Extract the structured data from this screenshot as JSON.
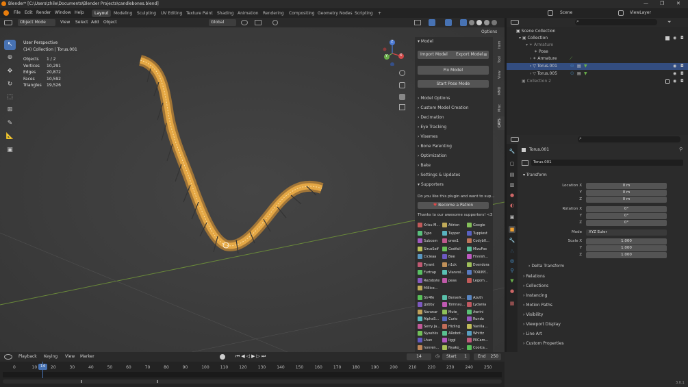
{
  "window": {
    "title": "Blender* [C:\\Users\\zhile\\Documents\\Blender Projects\\candlebones.blend]",
    "min_label": "—",
    "max_label": "❐",
    "close_label": "✕"
  },
  "menu": {
    "items": [
      "File",
      "Edit",
      "Render",
      "Window",
      "Help"
    ]
  },
  "workspaces": [
    "Layout",
    "Modeling",
    "Sculpting",
    "UV Editing",
    "Texture Paint",
    "Shading",
    "Animation",
    "Rendering",
    "Compositing",
    "Geometry Nodes",
    "Scripting"
  ],
  "workspace_add": "+",
  "scene": {
    "scene_label": "Scene",
    "viewlayer_label": "ViewLayer"
  },
  "viewport_header": {
    "mode": "Object Mode",
    "menus": [
      "View",
      "Select",
      "Add",
      "Object"
    ],
    "transform_orientation": "Global",
    "options_label": "Options"
  },
  "viewport_info": {
    "view_name": "User Perspective",
    "collection": "(14) Collection | Torus.001",
    "stats": [
      {
        "label": "Objects",
        "value": "1 / 2"
      },
      {
        "label": "Vertices",
        "value": "10,291"
      },
      {
        "label": "Edges",
        "value": "20,872"
      },
      {
        "label": "Faces",
        "value": "10,592"
      },
      {
        "label": "Triangles",
        "value": "19,526"
      }
    ]
  },
  "gizmo": {
    "x": "X",
    "y": "Y",
    "z": "Z"
  },
  "npanel": {
    "title": "Model",
    "import_label": "Import Model",
    "export_label": "Export Model",
    "fix_label": "Fix Model",
    "pose_label": "Start Pose Mode",
    "sections": [
      "Model Options",
      "Custom Model Creation",
      "Decimation",
      "Eye Tracking",
      "Visemes",
      "Bone Parenting",
      "Optimization",
      "Bake",
      "Settings & Updates",
      "Supporters"
    ],
    "support_text": "Do you like this plugin and want to sup...",
    "patron_label": "Become a Patron",
    "thanks_text": "Thanks to our awesome supporters! <3",
    "supporters_a": [
      "Krisu M...",
      "Atirion",
      "Googie",
      "Typo",
      "Tupper",
      "Tuppiest",
      "Subcom",
      "ones1",
      "Codyb0...",
      "SirusSelf",
      "Godfall",
      "MizuFox",
      "Cicieaa",
      "Bee",
      "Finnish...",
      "Tyrant",
      "n1ck",
      "Evendora",
      "Furtrap",
      "Vianvol...",
      "TORINY...",
      "Rezobyte",
      "peas",
      "Legom...",
      "Millice..."
    ],
    "supporters_b": [
      "Str4fe",
      "Berserk...",
      "Azuth",
      "gobby",
      "Tomnau...",
      "Lydania",
      "Naranar",
      "Mute_",
      "Awrini",
      "AlphaS...",
      "Curio",
      "Runda",
      "Serry Ja...",
      "Hizling",
      "Vanilla...",
      "Nyashks",
      "ARobot...",
      "Whittz",
      "Lhun",
      "liggi",
      "PKCam...",
      "honren...",
      "Nyako_...",
      "Coolca..."
    ]
  },
  "npanel_tabs": [
    "Item",
    "Tool",
    "View",
    "MMD",
    "Misc",
    "CATS"
  ],
  "outliner": {
    "scene_collection": "Scene Collection",
    "rows": [
      {
        "label": "Collection",
        "indent": 1
      },
      {
        "label": "Armature",
        "indent": 2
      },
      {
        "label": "Pose",
        "indent": 3
      },
      {
        "label": "Armature",
        "indent": 3
      },
      {
        "label": "Torus.001",
        "indent": 3
      },
      {
        "label": "Torus.005",
        "indent": 3
      },
      {
        "label": "Collection 2",
        "indent": 1
      }
    ]
  },
  "properties": {
    "object_name": "Torus.001",
    "data_name": "Torus.001",
    "transform_title": "Transform",
    "location_label": "Location X",
    "location": [
      "0 m",
      "0 m",
      "0 m"
    ],
    "rotation_label": "Rotation X",
    "rotation": [
      "0°",
      "0°",
      "0°"
    ],
    "mode_label": "Mode",
    "mode_value": "XYZ Euler",
    "scale_label": "Scale X",
    "scale": [
      "1.000",
      "1.000",
      "1.000"
    ],
    "y_label": "Y",
    "z_label": "Z",
    "delta_label": "Delta Transform",
    "sections": [
      "Relations",
      "Collections",
      "Instancing",
      "Motion Paths",
      "Visibility",
      "Viewport Display",
      "Line Art",
      "Custom Properties"
    ]
  },
  "timeline": {
    "menus": [
      "Playback",
      "Keying",
      "View",
      "Marker"
    ],
    "current_frame": "14",
    "start_label": "Start",
    "start_value": "1",
    "end_label": "End",
    "end_value": "250",
    "ticks": [
      "0",
      "10",
      "20",
      "30",
      "40",
      "50",
      "60",
      "70",
      "80",
      "90",
      "100",
      "110",
      "120",
      "130",
      "140",
      "150",
      "160",
      "170",
      "180",
      "190",
      "200",
      "210",
      "220",
      "230",
      "240",
      "250"
    ]
  },
  "status": {
    "version": "3.0.1"
  },
  "colors": {
    "accent": "#4772b3",
    "mesh": "#f0a030",
    "selected_row": "#334d80"
  }
}
